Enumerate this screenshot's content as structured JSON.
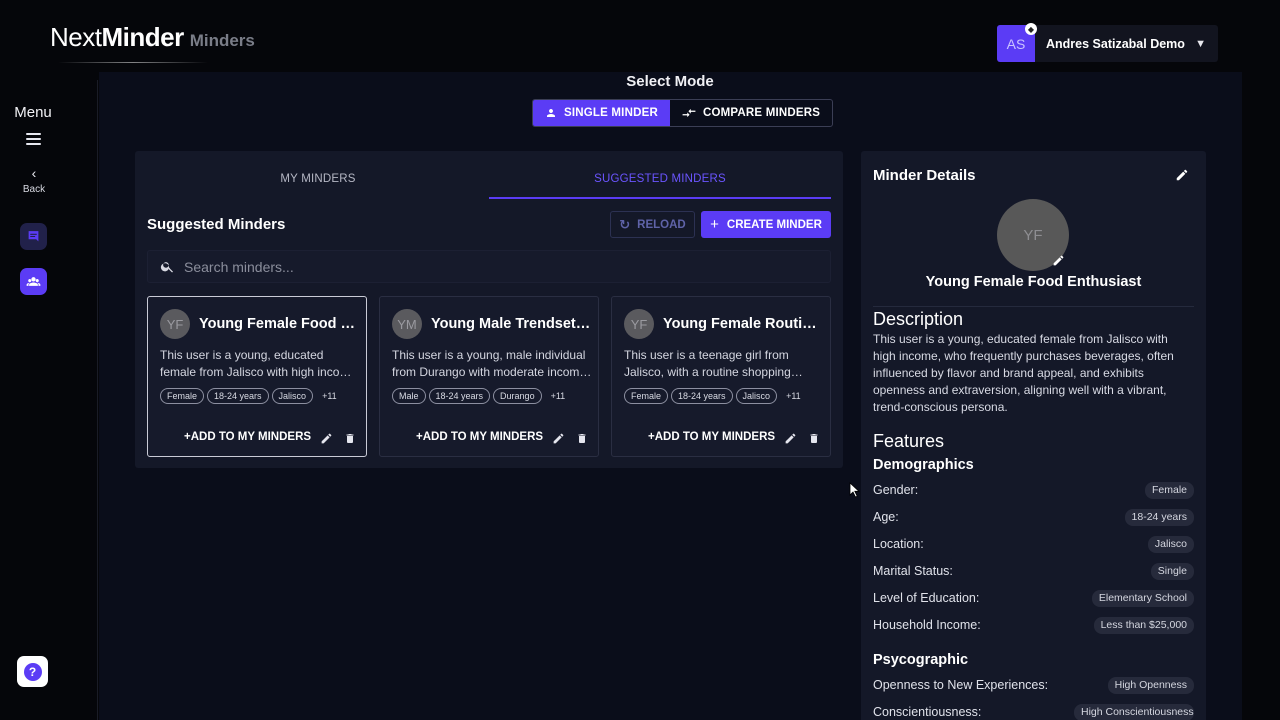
{
  "brand": {
    "logo_prefix": "Next",
    "logo_bold": "Minder",
    "section": "Minders"
  },
  "sidebar": {
    "menu_label": "Menu",
    "back_label": "Back"
  },
  "user": {
    "initials": "AS",
    "name": "Andres Satizabal Demo"
  },
  "mode": {
    "title": "Select Mode",
    "single_label": "SINGLE MINDER",
    "compare_label": "COMPARE MINDERS"
  },
  "tabs": {
    "my_minders": "MY MINDERS",
    "suggested_minders": "SUGGESTED MINDERS"
  },
  "list": {
    "title": "Suggested Minders",
    "reload_label": "RELOAD",
    "create_label": "CREATE MINDER",
    "search_placeholder": "Search minders...",
    "add_label": "ADD TO MY MINDERS",
    "cards": [
      {
        "initials": "YF",
        "title": "Young Female Food Enthusiast",
        "desc": "This user is a young, educated female from Jalisco with high income, who frequently purchases beverages",
        "chips": [
          "Female",
          "18-24 years",
          "Jalisco"
        ],
        "more": "+11"
      },
      {
        "initials": "YM",
        "title": "Young Male Trendsetter",
        "desc": "This user is a young, male individual from Durango with moderate income and trend-conscious habits",
        "chips": [
          "Male",
          "18-24 years",
          "Durango"
        ],
        "more": "+11"
      },
      {
        "initials": "YF",
        "title": "Young Female Routine Shopper",
        "desc": "This user is a teenage girl from Jalisco, with a routine shopping behaviour and steady preferences",
        "chips": [
          "Female",
          "18-24 years",
          "Jalisco"
        ],
        "more": "+11"
      }
    ]
  },
  "details": {
    "title": "Minder Details",
    "initials": "YF",
    "name": "Young Female Food Enthusiast",
    "description_heading": "Description",
    "description": "This user is a young, educated female from Jalisco with high income, who frequently purchases beverages, often influenced by flavor and brand appeal, and exhibits openness and extraversion, aligning well with a vibrant, trend-conscious persona.",
    "features_heading": "Features",
    "demographics_heading": "Demographics",
    "demographics": [
      {
        "label": "Gender:",
        "value": "Female"
      },
      {
        "label": "Age:",
        "value": "18-24 years"
      },
      {
        "label": "Location:",
        "value": "Jalisco"
      },
      {
        "label": "Marital Status:",
        "value": "Single"
      },
      {
        "label": "Level of Education:",
        "value": "Elementary School"
      },
      {
        "label": "Household Income:",
        "value": "Less than $25,000"
      }
    ],
    "psychographic_heading": "Psycographic",
    "psychographic": [
      {
        "label": "Openness to New Experiences:",
        "value": "High Openness"
      },
      {
        "label": "Conscientiousness:",
        "value": "High Conscientiousness"
      }
    ]
  },
  "icons": {
    "hamburger": "menu-icon",
    "back": "chevron-left-icon",
    "chat": "chat-icon",
    "group": "group-icon",
    "help": "help-icon",
    "search": "search-icon",
    "reload": "refresh-icon",
    "plus": "plus-icon",
    "edit": "pencil-icon",
    "delete": "trash-icon",
    "person": "person-icon",
    "compare": "compare-arrows-icon"
  },
  "colors": {
    "accent": "#5b3cf5",
    "panel": "#141828",
    "background": "#0a0d1a"
  }
}
